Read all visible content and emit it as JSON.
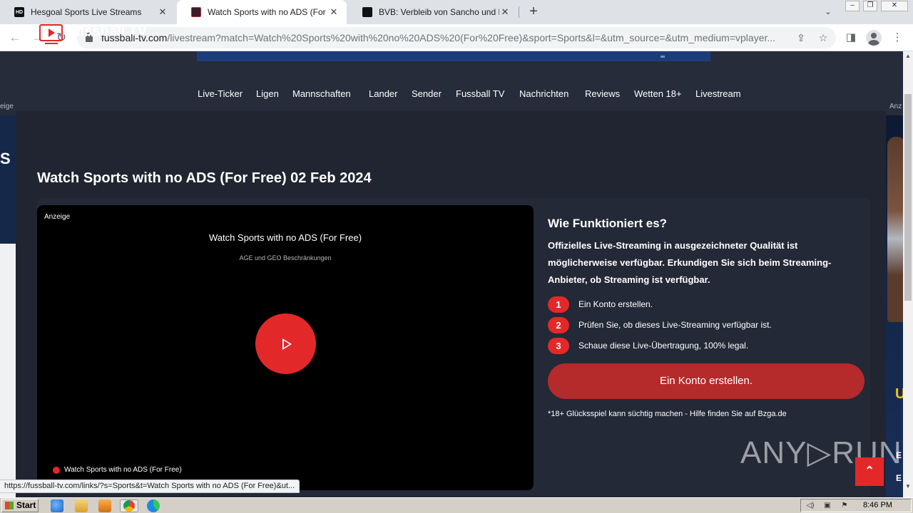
{
  "browser": {
    "tabs": [
      {
        "title": "Hesgoal Sports Live Streams",
        "favicon": "HD",
        "active": false
      },
      {
        "title": "Watch Sports with no ADS (For Free",
        "favicon": "",
        "active": true
      },
      {
        "title": "BVB: Verbleib von Sancho und Maats",
        "favicon": "",
        "active": false
      }
    ],
    "url_domain": "fussball-tv.com",
    "url_path": "/livestream?match=Watch%20Sports%20with%20no%20ADS%20(For%20Free)&sport=Sports&l=&utm_source=&utm_medium=vplayer...",
    "status_url": "https://fussball-tv.com/links/?s=Sports&t=Watch Sports with no ADS (For Free)&ut..."
  },
  "site": {
    "logo_text": "Fussball TV",
    "menu": [
      "Live-Ticker",
      "Ligen",
      "Mannschaften",
      "Lander",
      "Sender",
      "Fussball TV",
      "Nachrichten",
      "Reviews",
      "Wetten 18+",
      "Livestream"
    ],
    "ad_label_left": "eige",
    "ad_label_right": "Anz",
    "side_ad_left_letter": "S",
    "side_ad_right_letter": "U",
    "side_ad_right_b1": "E",
    "side_ad_right_b2": "E"
  },
  "page": {
    "title": "Watch Sports with no ADS (For Free) 02 Feb 2024"
  },
  "player": {
    "ad_label": "Anzeige",
    "title": "Watch Sports with no ADS (For Free)",
    "subtitle": "AGE und GEO Beschränkungen",
    "live_label": "Watch Sports with no ADS (For Free)"
  },
  "info": {
    "title": "Wie Funktioniert es?",
    "description": "Offizielles Live-Streaming in ausgezeichneter Qualität ist möglicherweise verfügbar. Erkundigen Sie sich beim Streaming-Anbieter, ob Streaming ist verfügbar.",
    "steps": [
      {
        "num": "1",
        "text": "Ein Konto erstellen."
      },
      {
        "num": "2",
        "text": "Prüfen Sie, ob dieses Live-Streaming verfügbar ist."
      },
      {
        "num": "3",
        "text": "Schaue diese Live-Übertragung, 100% legal."
      }
    ],
    "cta": "Ein Konto erstellen.",
    "disclaimer": "*18+ Glücksspiel kann süchtig machen - Hilfe finden Sie auf Bzga.de"
  },
  "overlay": {
    "watermark": "ANY▷RUN",
    "back_to_top": "⌃"
  },
  "taskbar": {
    "start_label": "Start",
    "clock": "8:46 PM"
  },
  "colors": {
    "accent_red": "#e3282a",
    "cta_red": "#b52a2b",
    "page_bg": "#262c39"
  }
}
